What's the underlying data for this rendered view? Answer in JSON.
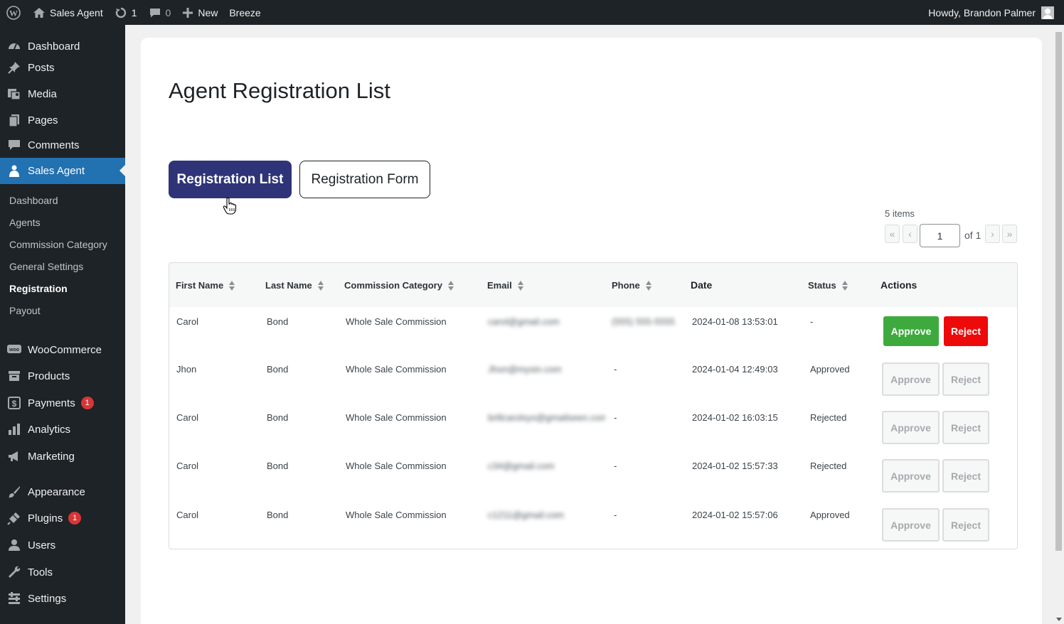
{
  "adminbar": {
    "site_name": "Sales Agent",
    "updates_count": "1",
    "comments_count": "0",
    "new_label": "New",
    "breeze_label": "Breeze",
    "howdy": "Howdy, Brandon Palmer"
  },
  "sidebar": {
    "items": [
      {
        "label": "Dashboard",
        "icon": "dashboard-icon"
      },
      {
        "label": "Posts",
        "icon": "pin-icon"
      },
      {
        "label": "Media",
        "icon": "media-icon"
      },
      {
        "label": "Pages",
        "icon": "pages-icon"
      },
      {
        "label": "Comments",
        "icon": "comment-icon"
      },
      {
        "label": "Sales Agent",
        "icon": "agent-icon"
      },
      {
        "label": "WooCommerce",
        "icon": "woo-icon"
      },
      {
        "label": "Products",
        "icon": "archive-icon"
      },
      {
        "label": "Payments",
        "icon": "payment-icon",
        "badge": "1"
      },
      {
        "label": "Analytics",
        "icon": "bar-chart-icon"
      },
      {
        "label": "Marketing",
        "icon": "megaphone-icon"
      },
      {
        "label": "Appearance",
        "icon": "brush-icon"
      },
      {
        "label": "Plugins",
        "icon": "plugin-icon",
        "badge": "1"
      },
      {
        "label": "Users",
        "icon": "user-icon"
      },
      {
        "label": "Tools",
        "icon": "wrench-icon"
      },
      {
        "label": "Settings",
        "icon": "settings-icon"
      }
    ],
    "submenu": [
      {
        "label": "Dashboard"
      },
      {
        "label": "Agents"
      },
      {
        "label": "Commission Category"
      },
      {
        "label": "General Settings"
      },
      {
        "label": "Registration"
      },
      {
        "label": "Payout"
      }
    ]
  },
  "main": {
    "title": "Agent Registration List",
    "tabs": [
      {
        "label": "Registration List"
      },
      {
        "label": "Registration Form"
      }
    ],
    "pagination": {
      "items": "5 items",
      "first": "«",
      "prev": "‹",
      "current_page": "1",
      "of_label": "of 1",
      "next": "›",
      "last": "»"
    },
    "table": {
      "columns": [
        "First Name",
        "Last Name",
        "Commission Category",
        "Email",
        "Phone",
        "Date",
        "Status",
        "Actions"
      ],
      "rows": [
        {
          "first": "Carol",
          "last": "Bond",
          "category": "Whole Sale Commission",
          "email": "carol@gmail.com",
          "phone": "(555) 555-5555",
          "date": "2024-01-08 13:53:01",
          "status": "-",
          "approve": "Approve",
          "reject": "Reject",
          "enabled": true
        },
        {
          "first": "Jhon",
          "last": "Bond",
          "category": "Whole Sale Commission",
          "email": "Jhon@mysin.com",
          "phone": "-",
          "date": "2024-01-04 12:49:03",
          "status": "Approved",
          "approve": "Approve",
          "reject": "Reject",
          "enabled": false
        },
        {
          "first": "Carol",
          "last": "Bond",
          "category": "Whole Sale Commission",
          "email": "brillcarolsys@gmailseen.com",
          "phone": "-",
          "date": "2024-01-02 16:03:15",
          "status": "Rejected",
          "approve": "Approve",
          "reject": "Reject",
          "enabled": false
        },
        {
          "first": "Carol",
          "last": "Bond",
          "category": "Whole Sale Commission",
          "email": "c34@gmail.com",
          "phone": "-",
          "date": "2024-01-02 15:57:33",
          "status": "Rejected",
          "approve": "Approve",
          "reject": "Reject",
          "enabled": false
        },
        {
          "first": "Carol",
          "last": "Bond",
          "category": "Whole Sale Commission",
          "email": "c1211@gmail.com",
          "phone": "-",
          "date": "2024-01-02 15:57:06",
          "status": "Approved",
          "approve": "Approve",
          "reject": "Reject",
          "enabled": false
        }
      ]
    }
  },
  "colors": {
    "accent": "#2f3478",
    "wp_blue": "#2271b1",
    "approve": "#3eaa3e",
    "reject": "#ee0a0a"
  }
}
